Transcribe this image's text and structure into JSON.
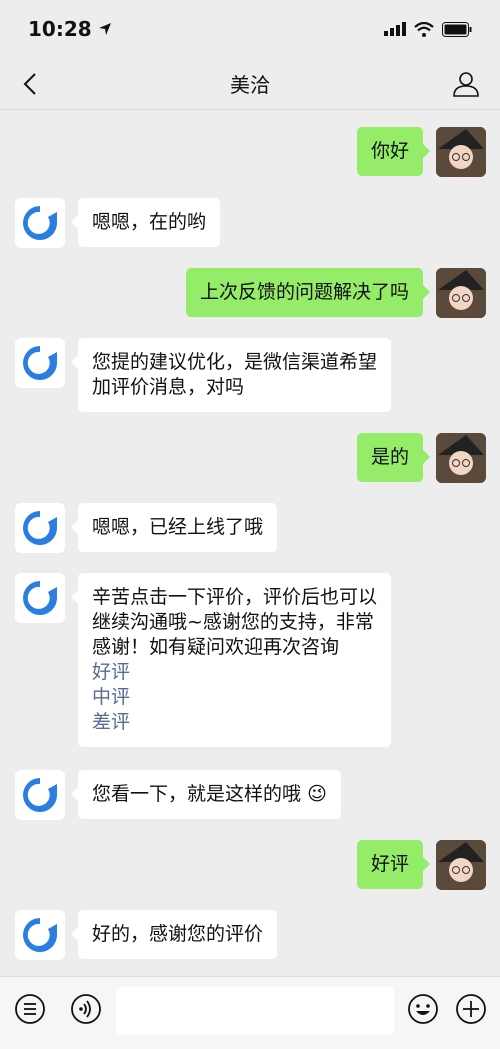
{
  "status_bar": {
    "time": "10:28"
  },
  "nav": {
    "title": "美洽"
  },
  "messages": [
    {
      "side": "right",
      "text": "你好"
    },
    {
      "side": "left",
      "text": "嗯嗯，在的哟"
    },
    {
      "side": "right",
      "text": "上次反馈的问题解决了吗"
    },
    {
      "side": "left",
      "line1": "您提的建议优化，是微信渠道希望",
      "line2": "加评价消息，对吗"
    },
    {
      "side": "right",
      "text": "是的"
    },
    {
      "side": "left",
      "text": "嗯嗯，已经上线了哦"
    },
    {
      "side": "left",
      "line1": "辛苦点击一下评价，评价后也可以",
      "line2": "继续沟通哦~感谢您的支持，非常",
      "line3": "感谢！如有疑问欢迎再次咨询",
      "links": [
        "好评",
        "中评",
        "差评"
      ]
    },
    {
      "side": "left",
      "text": "您看一下，就是这样的哦",
      "emoji": "😉"
    },
    {
      "side": "right",
      "text": "好评"
    },
    {
      "side": "left",
      "text": "好的，感谢您的评价"
    }
  ],
  "icons": {
    "back": "chevron-left-icon",
    "profile": "person-icon",
    "menu": "list-icon",
    "voice": "voice-icon",
    "emoji": "smiley-icon",
    "more": "plus-icon"
  },
  "colors": {
    "sent_bubble": "#95ec69",
    "received_bubble": "#ffffff",
    "link": "#576b95",
    "background": "#ededed"
  }
}
